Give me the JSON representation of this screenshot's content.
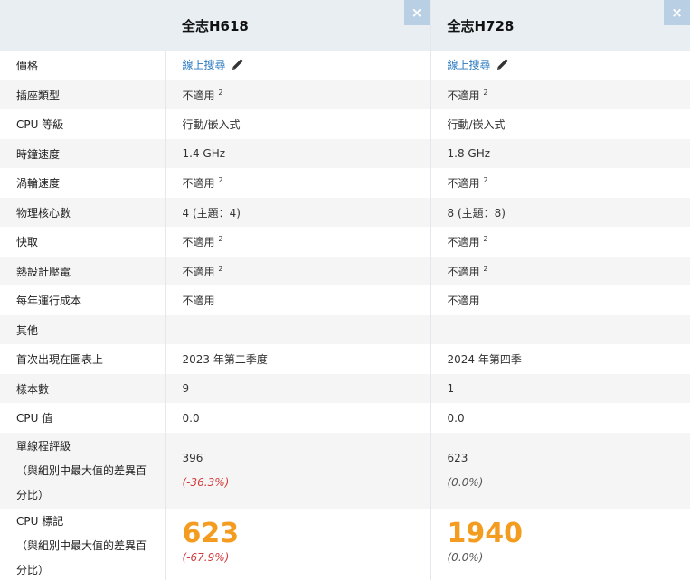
{
  "cpus": [
    {
      "name": "全志H618",
      "close": "×"
    },
    {
      "name": "全志H728",
      "close": "×"
    }
  ],
  "price": {
    "label": "價格",
    "link": "線上搜尋"
  },
  "rows": [
    {
      "label": "插座類型",
      "v1": "不適用",
      "v1sup": "2",
      "v2": "不適用",
      "v2sup": "2"
    },
    {
      "label": "CPU 等級",
      "v1": "行動/嵌入式",
      "v2": "行動/嵌入式"
    },
    {
      "label": "時鐘速度",
      "v1": "1.4 GHz",
      "v2": "1.8 GHz"
    },
    {
      "label": "渦輪速度",
      "v1": "不適用",
      "v1sup": "2",
      "v2": "不適用",
      "v2sup": "2"
    },
    {
      "label": "物理核心數",
      "v1": "4 (主題：4)",
      "v2": "8 (主題：8)"
    },
    {
      "label": "快取",
      "v1": "不適用",
      "v1sup": "2",
      "v2": "不適用",
      "v2sup": "2"
    },
    {
      "label": "熱設計壓電",
      "v1": "不適用",
      "v1sup": "2",
      "v2": "不適用",
      "v2sup": "2"
    },
    {
      "label": "每年運行成本",
      "v1": "不適用",
      "v2": "不適用"
    },
    {
      "label": "其他",
      "v1": "",
      "v2": ""
    },
    {
      "label": "首次出現在圖表上",
      "v1": "2023 年第二季度",
      "v2": "2024 年第四季"
    },
    {
      "label": "樣本數",
      "v1": "9",
      "v2": "1"
    },
    {
      "label": "CPU 值",
      "v1": "0.0",
      "v2": "0.0"
    }
  ],
  "single_thread": {
    "label": "單線程評級",
    "sub1": "（與組別中最大值的差異百",
    "sub2": "分比）",
    "v1": "396",
    "p1": "(-36.3%)",
    "v2": "623",
    "p2": "(0.0%)"
  },
  "cpu_mark": {
    "label": "CPU 標記",
    "sub1": "（與組別中最大值的差異百",
    "sub2": "分比）",
    "v1": "623",
    "p1": "(-67.9%)",
    "v2": "1940",
    "p2": "(0.0%)"
  }
}
